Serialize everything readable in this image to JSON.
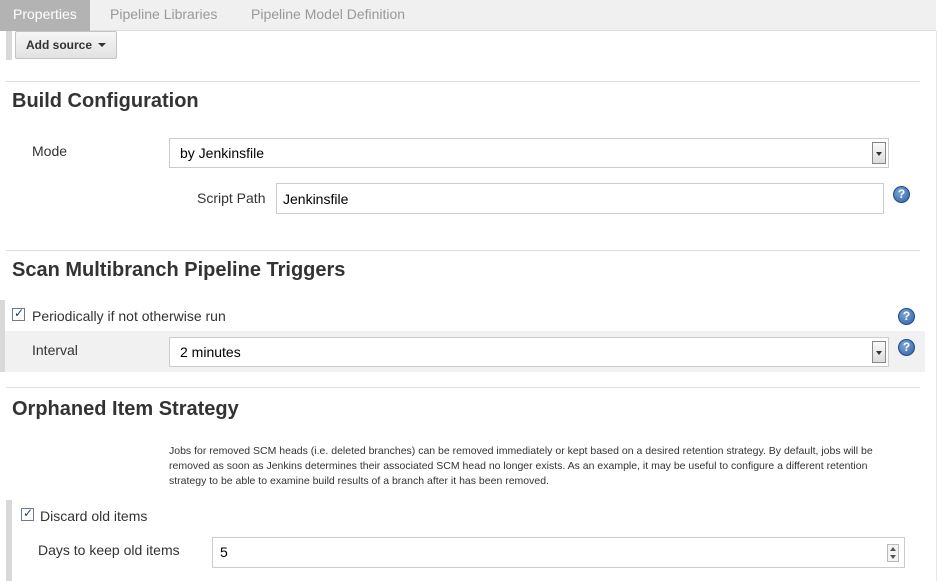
{
  "tabs": [
    {
      "label": "Properties",
      "active": true
    },
    {
      "label": "Pipeline Libraries",
      "active": false
    },
    {
      "label": "Pipeline Model Definition",
      "active": false
    }
  ],
  "add_source": {
    "label": "Add source"
  },
  "build_configuration": {
    "title": "Build Configuration",
    "mode_label": "Mode",
    "mode_value": "by Jenkinsfile",
    "script_path_label": "Script Path",
    "script_path_value": "Jenkinsfile"
  },
  "triggers": {
    "title": "Scan Multibranch Pipeline Triggers",
    "periodic_label": "Periodically if not otherwise run",
    "periodic_checked": true,
    "interval_label": "Interval",
    "interval_value": "2 minutes"
  },
  "orphaned": {
    "title": "Orphaned Item Strategy",
    "description": "Jobs for removed SCM heads (i.e. deleted branches) can be removed immediately or kept based on a desired retention strategy. By default, jobs will be removed as soon as Jenkins determines their associated SCM head no longer exists. As an example, it may be useful to configure a different retention strategy to be able to examine build results of a branch after it has been removed.",
    "discard_label": "Discard old items",
    "discard_checked": true,
    "days_label": "Days to keep old items",
    "days_value": "5"
  },
  "icons": {
    "help": "help-icon",
    "check": "checkmark-icon",
    "dropdown": "chevron-down-icon"
  },
  "colors": {
    "active_tab_bg": "#b3b3b3",
    "help_icon": "#2d5fa3"
  }
}
